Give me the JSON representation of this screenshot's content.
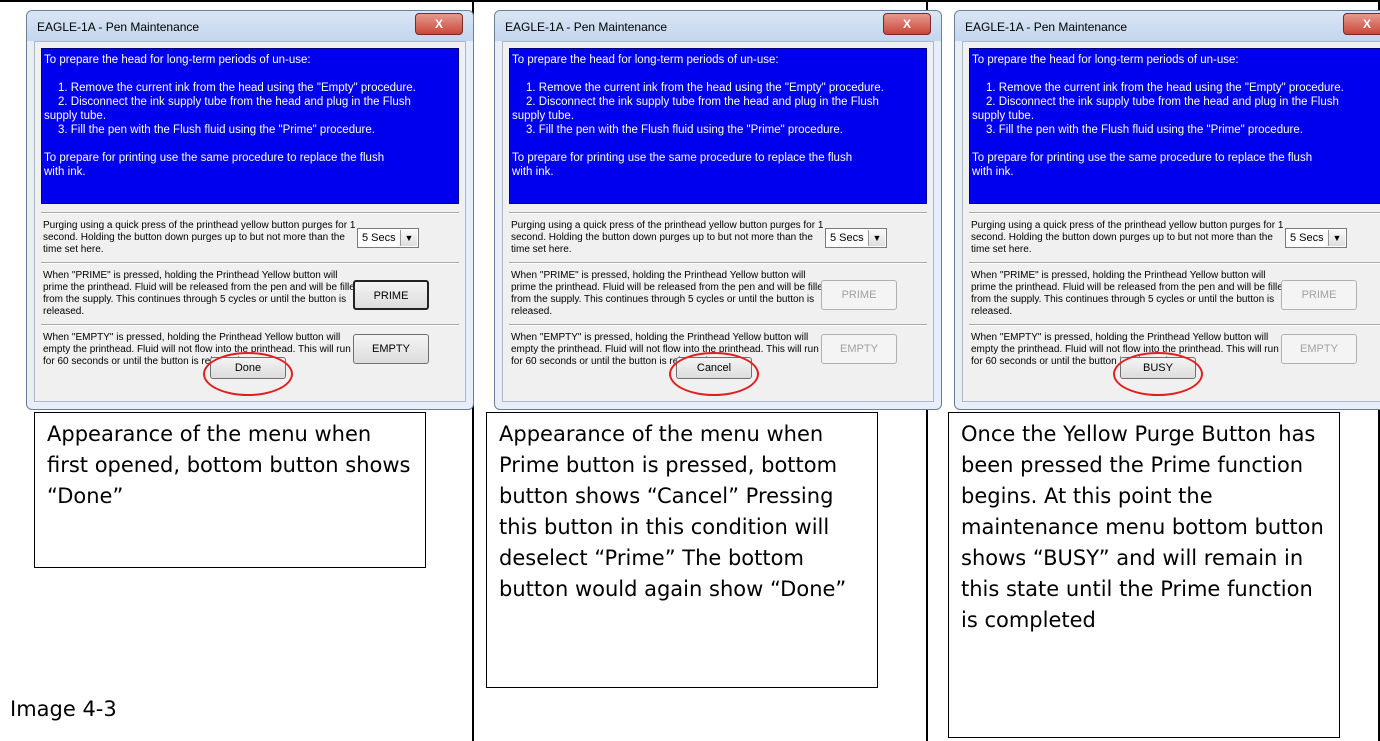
{
  "window": {
    "title": "EAGLE-1A - Pen Maintenance",
    "close_label": "X",
    "info_lines": [
      "To prepare the head for long-term periods of un-use:",
      "",
      "1. Remove the current ink from the head using the \"Empty\" procedure.",
      "2. Disconnect the ink supply tube from the head and plug in the Flush",
      "supply tube.",
      "3. Fill the pen with the Flush fluid using the \"Prime\" procedure.",
      "",
      "To prepare for printing use the same procedure to replace the flush",
      "with ink."
    ],
    "purge_text": "Purging using a quick press of the printhead yellow button purges for 1 second.  Holding the button down purges up to but not more than the time set here.",
    "purge_select_value": "5 Secs",
    "prime_text": "When \"PRIME\" is pressed, holding the Printhead Yellow button will prime the printhead. Fluid will be released from the pen and will be filled from the supply.  This continues through 5 cycles or until the button is released.",
    "prime_button": "PRIME",
    "empty_text": "When \"EMPTY\" is pressed, holding the Printhead Yellow button will empty the printhead. Fluid will not flow into the printhead. This will run for 60 seconds or until the button is released.",
    "empty_button": "EMPTY"
  },
  "panels": [
    {
      "bottom_button": "Done",
      "caption": "Appearance of the menu when first opened, bottom button shows “Done”"
    },
    {
      "bottom_button": "Cancel",
      "caption": "Appearance of the menu when Prime button is pressed, bottom button shows “Cancel” Pressing this button in this condition will deselect “Prime” The bottom button would again show “Done”"
    },
    {
      "bottom_button": "BUSY",
      "caption": "Once the Yellow Purge Button has been pressed the Prime function begins. At this point the maintenance menu bottom button shows “BUSY” and will remain in this state until the Prime function is completed"
    }
  ],
  "image_label": "Image 4-3"
}
